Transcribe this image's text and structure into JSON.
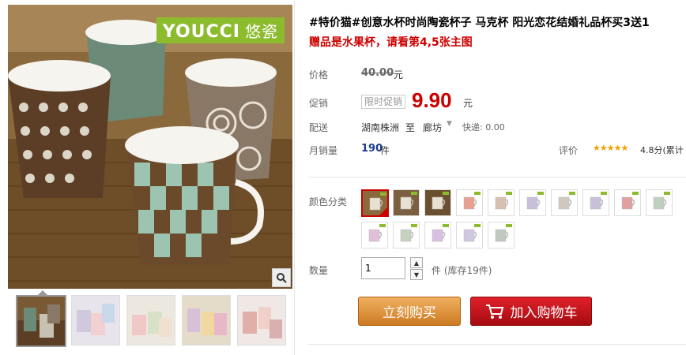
{
  "product": {
    "title": "#特价猫#创意水杯时尚陶瓷杯子 马克杯 阳光恋花结婚礼品杯买3送1",
    "subtitle": "赠品是水果杯，请看第4,5张主图",
    "brand_logo": "YOUCCI",
    "brand_logo_cn": "悠瓷"
  },
  "price": {
    "label": "价格",
    "original": "40.00",
    "unit": "元"
  },
  "promo": {
    "label": "促销",
    "tag": "限时促销",
    "price": "9.90",
    "unit": "元"
  },
  "shipping": {
    "label": "配送",
    "from": "湖南株洲",
    "to_word": "至",
    "to": "廊坊",
    "method": "快递: 0.00"
  },
  "sales": {
    "label": "月销量",
    "count": "190",
    "unit": "件",
    "rating_label": "评价",
    "stars": "★★★★★",
    "score": "4.8分(累计"
  },
  "color": {
    "label": "颜色分类",
    "selected_index": 0,
    "swatches": [
      {
        "id": 1,
        "color": "#8a6a3a"
      },
      {
        "id": 2,
        "color": "#7a6040"
      },
      {
        "id": 3,
        "color": "#6a5030"
      },
      {
        "id": 4,
        "color": "#e8a090"
      },
      {
        "id": 5,
        "color": "#d8c0b0"
      },
      {
        "id": 6,
        "color": "#c8c0d8"
      },
      {
        "id": 7,
        "color": "#d0c8c0"
      },
      {
        "id": 8,
        "color": "#c8c0d8"
      },
      {
        "id": 9,
        "color": "#e0a0a0"
      },
      {
        "id": 10,
        "color": "#c0d0c0"
      },
      {
        "id": 11,
        "color": "#e0c0d8"
      },
      {
        "id": 12,
        "color": "#c8d0c0"
      },
      {
        "id": 13,
        "color": "#d8c0e0"
      },
      {
        "id": 14,
        "color": "#d0c8e0"
      },
      {
        "id": 15,
        "color": "#c0c8c0"
      }
    ]
  },
  "quantity": {
    "label": "数量",
    "value": "1",
    "stock": "件 (库存19件)"
  },
  "actions": {
    "buy_now": "立刻购买",
    "add_cart": "加入购物车"
  },
  "colors": {
    "accent_red": "#cc0000",
    "buy_orange": "#cc7a22",
    "cart_red": "#b00c10"
  }
}
